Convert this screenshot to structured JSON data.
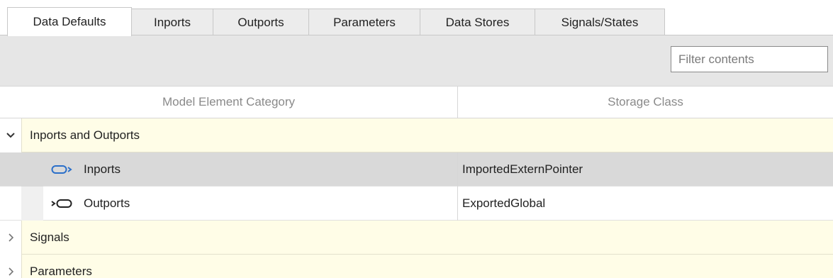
{
  "tabs": [
    {
      "label": "Data Defaults",
      "active": true
    },
    {
      "label": "Inports",
      "active": false
    },
    {
      "label": "Outports",
      "active": false
    },
    {
      "label": "Parameters",
      "active": false
    },
    {
      "label": "Data Stores",
      "active": false
    },
    {
      "label": "Signals/States",
      "active": false
    }
  ],
  "filter": {
    "placeholder": "Filter contents",
    "value": ""
  },
  "columns": {
    "category": "Model Element Category",
    "storage": "Storage Class"
  },
  "categories": [
    {
      "label": "Inports and Outports",
      "expanded": true,
      "toggle_icon": "chevron-down-icon",
      "children": [
        {
          "label": "Inports",
          "storage_class": "ImportedExternPointer",
          "icon": "inport-icon",
          "selected": true
        },
        {
          "label": "Outports",
          "storage_class": "ExportedGlobal",
          "icon": "outport-icon",
          "selected": false
        }
      ]
    },
    {
      "label": "Signals",
      "expanded": false,
      "toggle_icon": "chevron-right-icon"
    },
    {
      "label": "Parameters",
      "expanded": false,
      "toggle_icon": "chevron-right-icon"
    }
  ],
  "colors": {
    "category_band": "#fffde7",
    "selected_row": "#d9d9d9",
    "toolbar": "#e6e6e6",
    "inport_icon": "#2a6fc9"
  }
}
